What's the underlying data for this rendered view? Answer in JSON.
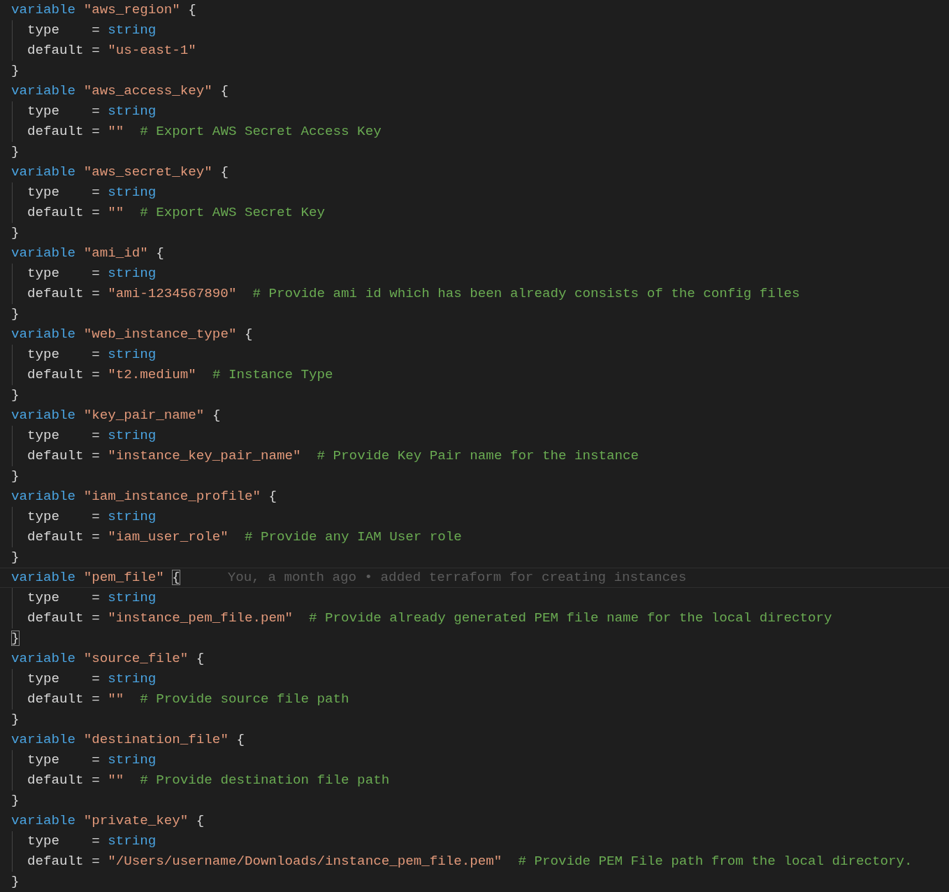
{
  "editor": {
    "lines": [
      {
        "indented": false,
        "tokens": [
          {
            "kind": "kw",
            "text": "variable"
          },
          {
            "kind": "str",
            "text": "\"aws_region\""
          },
          {
            "kind": "plain",
            "text": "{"
          }
        ]
      },
      {
        "indented": true,
        "tokens": [
          {
            "kind": "plain",
            "text": "type    ="
          },
          {
            "kind": "kw",
            "text": "string"
          }
        ]
      },
      {
        "indented": true,
        "tokens": [
          {
            "kind": "plain",
            "text": "default ="
          },
          {
            "kind": "str",
            "text": "\"us-east-1\""
          }
        ]
      },
      {
        "indented": false,
        "tokens": [
          {
            "kind": "plain",
            "text": "}"
          }
        ]
      },
      {
        "indented": false,
        "tokens": [
          {
            "kind": "kw",
            "text": "variable"
          },
          {
            "kind": "str",
            "text": "\"aws_access_key\""
          },
          {
            "kind": "plain",
            "text": "{"
          }
        ]
      },
      {
        "indented": true,
        "tokens": [
          {
            "kind": "plain",
            "text": "type    ="
          },
          {
            "kind": "kw",
            "text": "string"
          }
        ]
      },
      {
        "indented": true,
        "tokens": [
          {
            "kind": "plain",
            "text": "default ="
          },
          {
            "kind": "str",
            "text": "\"\""
          },
          {
            "kind": "cm",
            "text": "# Export AWS Secret Access Key"
          }
        ]
      },
      {
        "indented": false,
        "tokens": [
          {
            "kind": "plain",
            "text": "}"
          }
        ]
      },
      {
        "indented": false,
        "tokens": [
          {
            "kind": "kw",
            "text": "variable"
          },
          {
            "kind": "str",
            "text": "\"aws_secret_key\""
          },
          {
            "kind": "plain",
            "text": "{"
          }
        ]
      },
      {
        "indented": true,
        "tokens": [
          {
            "kind": "plain",
            "text": "type    ="
          },
          {
            "kind": "kw",
            "text": "string"
          }
        ]
      },
      {
        "indented": true,
        "tokens": [
          {
            "kind": "plain",
            "text": "default ="
          },
          {
            "kind": "str",
            "text": "\"\""
          },
          {
            "kind": "cm",
            "text": "# Export AWS Secret Key"
          }
        ]
      },
      {
        "indented": false,
        "tokens": [
          {
            "kind": "plain",
            "text": "}"
          }
        ]
      },
      {
        "indented": false,
        "tokens": [
          {
            "kind": "kw",
            "text": "variable"
          },
          {
            "kind": "str",
            "text": "\"ami_id\""
          },
          {
            "kind": "plain",
            "text": "{"
          }
        ]
      },
      {
        "indented": true,
        "tokens": [
          {
            "kind": "plain",
            "text": "type    ="
          },
          {
            "kind": "kw",
            "text": "string"
          }
        ]
      },
      {
        "indented": true,
        "tokens": [
          {
            "kind": "plain",
            "text": "default ="
          },
          {
            "kind": "str",
            "text": "\"ami-1234567890\""
          },
          {
            "kind": "cm",
            "text": "# Provide ami id which has been already consists of the config files"
          }
        ]
      },
      {
        "indented": false,
        "tokens": [
          {
            "kind": "plain",
            "text": "}"
          }
        ]
      },
      {
        "indented": false,
        "tokens": [
          {
            "kind": "kw",
            "text": "variable"
          },
          {
            "kind": "str",
            "text": "\"web_instance_type\""
          },
          {
            "kind": "plain",
            "text": "{"
          }
        ]
      },
      {
        "indented": true,
        "tokens": [
          {
            "kind": "plain",
            "text": "type    ="
          },
          {
            "kind": "kw",
            "text": "string"
          }
        ]
      },
      {
        "indented": true,
        "tokens": [
          {
            "kind": "plain",
            "text": "default ="
          },
          {
            "kind": "str",
            "text": "\"t2.medium\""
          },
          {
            "kind": "cm",
            "text": "# Instance Type"
          }
        ]
      },
      {
        "indented": false,
        "tokens": [
          {
            "kind": "plain",
            "text": "}"
          }
        ]
      },
      {
        "indented": false,
        "tokens": [
          {
            "kind": "kw",
            "text": "variable"
          },
          {
            "kind": "str",
            "text": "\"key_pair_name\""
          },
          {
            "kind": "plain",
            "text": "{"
          }
        ]
      },
      {
        "indented": true,
        "tokens": [
          {
            "kind": "plain",
            "text": "type    ="
          },
          {
            "kind": "kw",
            "text": "string"
          }
        ]
      },
      {
        "indented": true,
        "tokens": [
          {
            "kind": "plain",
            "text": "default ="
          },
          {
            "kind": "str",
            "text": "\"instance_key_pair_name\""
          },
          {
            "kind": "cm",
            "text": "# Provide Key Pair name for the instance"
          }
        ]
      },
      {
        "indented": false,
        "tokens": [
          {
            "kind": "plain",
            "text": "}"
          }
        ]
      },
      {
        "indented": false,
        "tokens": [
          {
            "kind": "kw",
            "text": "variable"
          },
          {
            "kind": "str",
            "text": "\"iam_instance_profile\""
          },
          {
            "kind": "plain",
            "text": "{"
          }
        ]
      },
      {
        "indented": true,
        "tokens": [
          {
            "kind": "plain",
            "text": "type    ="
          },
          {
            "kind": "kw",
            "text": "string"
          }
        ]
      },
      {
        "indented": true,
        "tokens": [
          {
            "kind": "plain",
            "text": "default ="
          },
          {
            "kind": "str",
            "text": "\"iam_user_role\""
          },
          {
            "kind": "cm",
            "text": "# Provide any IAM User role"
          }
        ]
      },
      {
        "indented": false,
        "tokens": [
          {
            "kind": "plain",
            "text": "}"
          }
        ]
      },
      {
        "indented": false,
        "current": true,
        "blame": "You, a month ago • added terraform for creating instances",
        "tokens": [
          {
            "kind": "kw",
            "text": "variable"
          },
          {
            "kind": "str",
            "text": "\"pem_file\""
          },
          {
            "kind": "bm",
            "text": "{"
          }
        ]
      },
      {
        "indented": true,
        "tokens": [
          {
            "kind": "plain",
            "text": "type    ="
          },
          {
            "kind": "kw",
            "text": "string"
          }
        ]
      },
      {
        "indented": true,
        "tokens": [
          {
            "kind": "plain",
            "text": "default ="
          },
          {
            "kind": "str",
            "text": "\"instance_pem_file.pem\""
          },
          {
            "kind": "cm",
            "text": "# Provide already generated PEM file name for the local directory"
          }
        ]
      },
      {
        "indented": false,
        "tokens": [
          {
            "kind": "bm",
            "text": "}"
          }
        ]
      },
      {
        "indented": false,
        "tokens": [
          {
            "kind": "kw",
            "text": "variable"
          },
          {
            "kind": "str",
            "text": "\"source_file\""
          },
          {
            "kind": "plain",
            "text": "{"
          }
        ]
      },
      {
        "indented": true,
        "tokens": [
          {
            "kind": "plain",
            "text": "type    ="
          },
          {
            "kind": "kw",
            "text": "string"
          }
        ]
      },
      {
        "indented": true,
        "tokens": [
          {
            "kind": "plain",
            "text": "default ="
          },
          {
            "kind": "str",
            "text": "\"\""
          },
          {
            "kind": "cm",
            "text": "# Provide source file path"
          }
        ]
      },
      {
        "indented": false,
        "tokens": [
          {
            "kind": "plain",
            "text": "}"
          }
        ]
      },
      {
        "indented": false,
        "tokens": [
          {
            "kind": "kw",
            "text": "variable"
          },
          {
            "kind": "str",
            "text": "\"destination_file\""
          },
          {
            "kind": "plain",
            "text": "{"
          }
        ]
      },
      {
        "indented": true,
        "tokens": [
          {
            "kind": "plain",
            "text": "type    ="
          },
          {
            "kind": "kw",
            "text": "string"
          }
        ]
      },
      {
        "indented": true,
        "tokens": [
          {
            "kind": "plain",
            "text": "default ="
          },
          {
            "kind": "str",
            "text": "\"\""
          },
          {
            "kind": "cm",
            "text": "# Provide destination file path"
          }
        ]
      },
      {
        "indented": false,
        "tokens": [
          {
            "kind": "plain",
            "text": "}"
          }
        ]
      },
      {
        "indented": false,
        "tokens": [
          {
            "kind": "kw",
            "text": "variable"
          },
          {
            "kind": "str",
            "text": "\"private_key\""
          },
          {
            "kind": "plain",
            "text": "{"
          }
        ]
      },
      {
        "indented": true,
        "tokens": [
          {
            "kind": "plain",
            "text": "type    ="
          },
          {
            "kind": "kw",
            "text": "string"
          }
        ]
      },
      {
        "indented": true,
        "tokens": [
          {
            "kind": "plain",
            "text": "default ="
          },
          {
            "kind": "str",
            "text": "\"/Users/username/Downloads/instance_pem_file.pem\""
          },
          {
            "kind": "cm",
            "text": "# Provide PEM File path from the local directory."
          }
        ]
      },
      {
        "indented": false,
        "tokens": [
          {
            "kind": "plain",
            "text": "}"
          }
        ]
      }
    ]
  }
}
